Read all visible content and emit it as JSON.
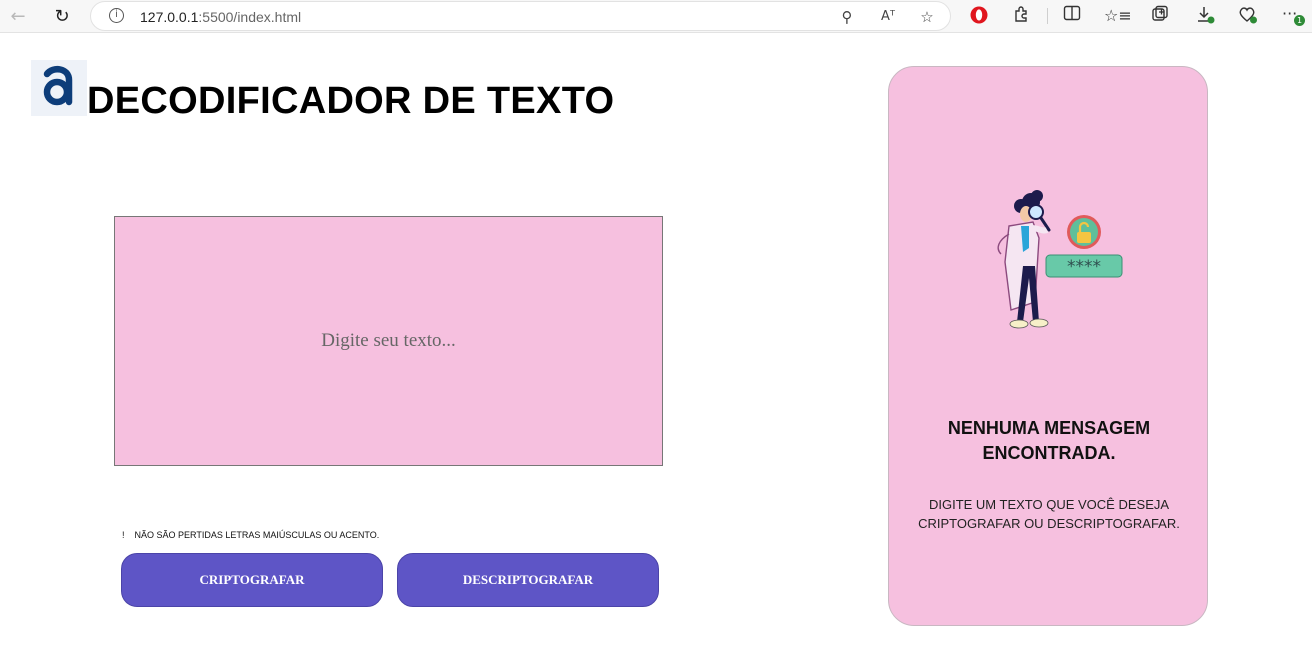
{
  "browser": {
    "url_host": "127.0.0.1",
    "url_rest": ":5500/index.html",
    "extension_badge": "1"
  },
  "page": {
    "logo_letter": "a",
    "title": "DECODIFICADOR DE TEXTO",
    "input_placeholder": "Digite seu texto...",
    "warning_icon": "!",
    "warning_text": "NÃO SÃO PERTIDAS LETRAS MAIÚSCULAS OU ACENTO.",
    "encrypt_label": "CRIPTOGRAFAR",
    "decrypt_label": "DESCRIPTOGRAFAR"
  },
  "panel": {
    "heading_line1": "NENHUMA MENSAGEM",
    "heading_line2": "ENCONTRADA.",
    "desc_line1": "DIGITE UM TEXTO QUE VOCÊ DESEJA",
    "desc_line2": "CRIPTOGRAFAR OU DESCRIPTOGRAFAR.",
    "illustration_password": "****"
  },
  "colors": {
    "pink": "#f6c0df",
    "button": "#5e55c6",
    "logo_blue": "#0d3d7a"
  }
}
